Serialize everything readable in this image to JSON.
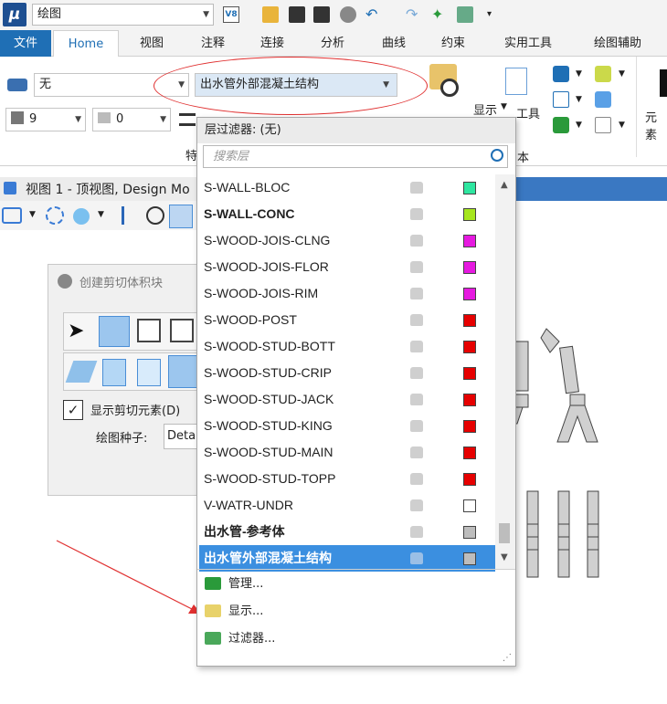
{
  "quick_access": {
    "app_logo": "μ",
    "workspace": "绘图",
    "v8_label": "V8"
  },
  "ribbon": {
    "tabs": [
      "文件",
      "Home",
      "视图",
      "注释",
      "连接",
      "分析",
      "曲线",
      "约束",
      "实用工具",
      "绘图辅助"
    ],
    "level_combo": "无",
    "layer_combo": "出水管外部混凝土结构",
    "color_combo": "9",
    "weight_combo": "0",
    "show_label": "显示",
    "tool_label": "工具",
    "element_label": "元素",
    "group_label_left": "特",
    "group_label_right": "本"
  },
  "view": {
    "title": "视图 1 - 顶视图, Design Mo"
  },
  "dialog": {
    "title": "创建剪切体积块",
    "show_clip_label": "显示剪切元素(D)",
    "seed_label": "绘图种子:",
    "seed_value": "Deta"
  },
  "layer_dropdown": {
    "filter_header": "层过滤器: (无)",
    "search_placeholder": "搜索层",
    "layers": [
      {
        "name": "S-WALL-BLOC",
        "color": "#2ee6a0",
        "bold": false,
        "selected": false
      },
      {
        "name": "S-WALL-CONC",
        "color": "#a6e61e",
        "bold": true,
        "selected": false
      },
      {
        "name": "S-WOOD-JOIS-CLNG",
        "color": "#e619e0",
        "bold": false,
        "selected": false
      },
      {
        "name": "S-WOOD-JOIS-FLOR",
        "color": "#e619e0",
        "bold": false,
        "selected": false
      },
      {
        "name": "S-WOOD-JOIS-RIM",
        "color": "#e619e0",
        "bold": false,
        "selected": false
      },
      {
        "name": "S-WOOD-POST",
        "color": "#e60000",
        "bold": false,
        "selected": false
      },
      {
        "name": "S-WOOD-STUD-BOTT",
        "color": "#e60000",
        "bold": false,
        "selected": false
      },
      {
        "name": "S-WOOD-STUD-CRIP",
        "color": "#e60000",
        "bold": false,
        "selected": false
      },
      {
        "name": "S-WOOD-STUD-JACK",
        "color": "#e60000",
        "bold": false,
        "selected": false
      },
      {
        "name": "S-WOOD-STUD-KING",
        "color": "#e60000",
        "bold": false,
        "selected": false
      },
      {
        "name": "S-WOOD-STUD-MAIN",
        "color": "#e60000",
        "bold": false,
        "selected": false
      },
      {
        "name": "S-WOOD-STUD-TOPP",
        "color": "#e60000",
        "bold": false,
        "selected": false
      },
      {
        "name": "V-WATR-UNDR",
        "color": "#ffffff",
        "bold": false,
        "selected": false
      },
      {
        "name": "出水管-参考体",
        "color": "#bdbdbd",
        "bold": true,
        "selected": false
      },
      {
        "name": "出水管外部混凝土结构",
        "color": "#bdbdbd",
        "bold": true,
        "selected": true
      }
    ],
    "menu": [
      "管理...",
      "显示...",
      "过滤器..."
    ]
  }
}
